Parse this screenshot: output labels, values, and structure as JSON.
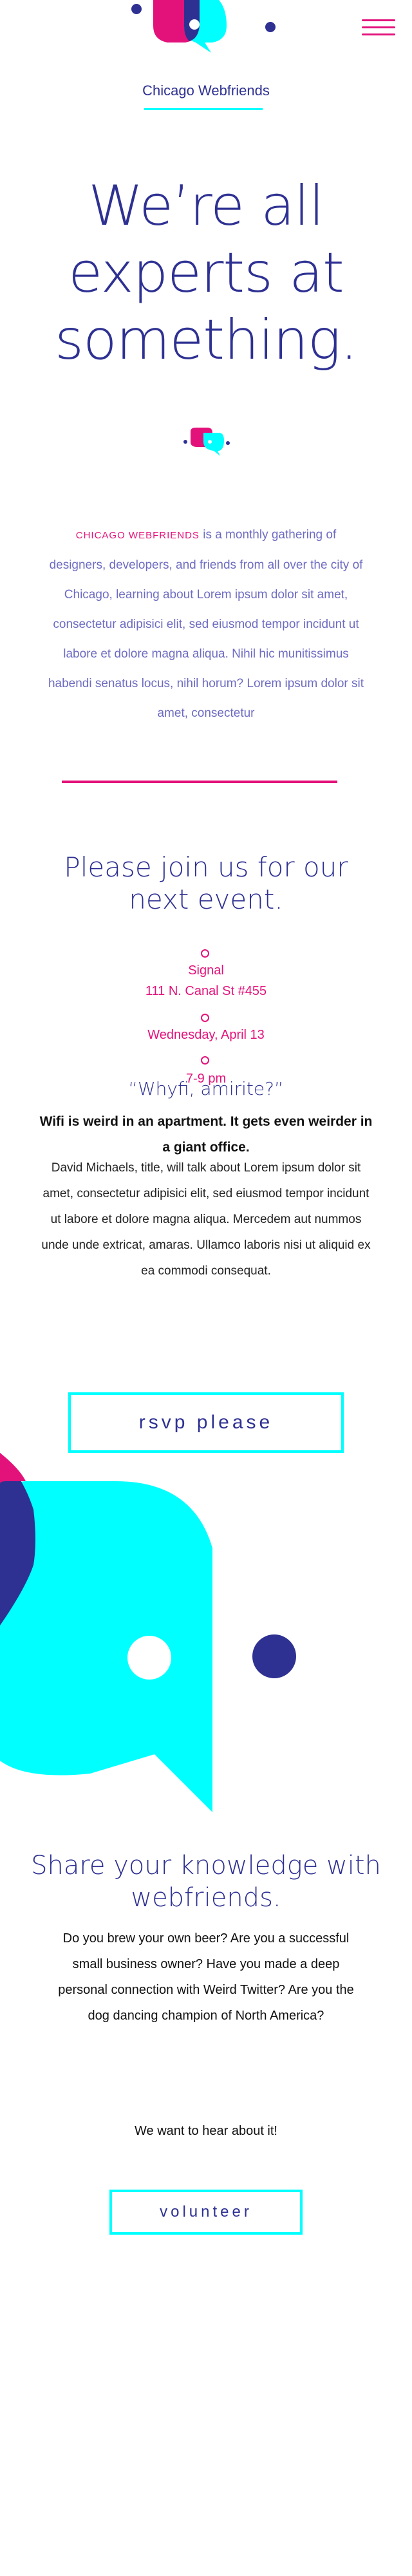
{
  "header": {
    "site_name": "Chicago Webfriends"
  },
  "hero": {
    "title_line1": "We’re all",
    "title_line2": "experts at",
    "title_line3": "something."
  },
  "intro": {
    "brand": "CHICAGO WEBFRIENDS",
    "text": " is a monthly gathering of designers, developers, and friends from all over the city of Chicago, learning about Lorem ipsum dolor sit amet, consectetur adipisici elit, sed eiusmod tempor incidunt ut labore et dolore magna aliqua. Nihil hic munitissimus habendi senatus locus, nihil horum? Lorem ipsum dolor sit amet, consectetur"
  },
  "event": {
    "title": "Please join us for our next event.",
    "venue": "Signal",
    "address": "111 N. Canal St #455",
    "date": "Wednesday, April 13",
    "time": "7-9 pm",
    "talk_title": "“Whyfi, amirite?”",
    "talk_lead": "Wifi is weird in an apartment. It gets even weirder in a giant office.",
    "talk_desc": "David Michaels, title, will talk about Lorem ipsum dolor sit amet, consectetur adipisici elit, sed eiusmod tempor incidunt ut labore et dolore magna aliqua. Mercedem aut nummos unde unde extricat, amaras. Ullamco laboris nisi ut aliquid ex ea commodi consequat.",
    "rsvp_label": "rsvp please"
  },
  "share": {
    "title": "Share your knowledge with webfriends.",
    "body": "Do you brew your own beer? Are you a successful small business owner? Have you made a deep personal connection with Weird Twitter? Are you the dog dancing champion of North America?",
    "cta": "We want to hear about it!",
    "volunteer_label": "volunteer"
  },
  "colors": {
    "navy": "#2e3192",
    "pink": "#e3127b",
    "cyan": "#00ffff",
    "lavender": "#6d6bc1"
  }
}
